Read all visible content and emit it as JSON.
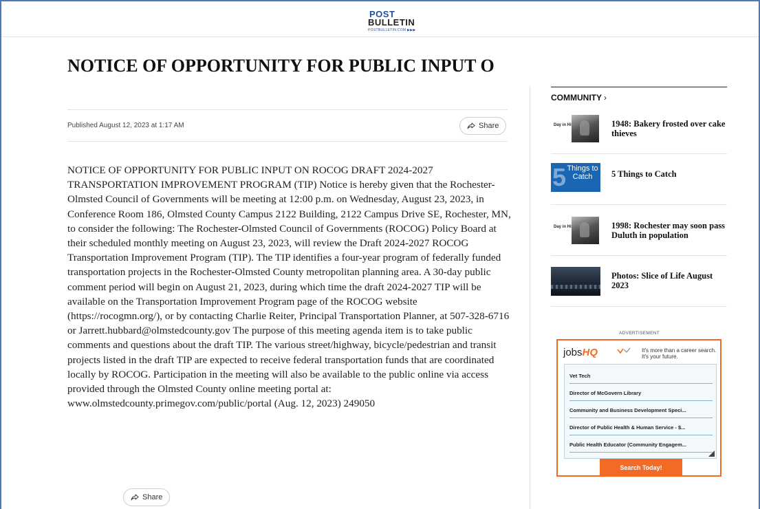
{
  "header": {
    "logo_line1": "POST",
    "logo_line2": "BULLETIN",
    "logo_line3": "POSTBULLETIN.COM ▶▶▶"
  },
  "article": {
    "headline": "NOTICE OF OPPORTUNITY FOR PUBLIC INPUT O",
    "published": "Published August 12, 2023 at 1:17 AM",
    "share_label": "Share",
    "body": "NOTICE OF OPPORTUNITY FOR PUBLIC INPUT ON ROCOG DRAFT 2024-2027 TRANSPORTATION IMPROVEMENT PROGRAM (TIP) Notice is hereby given that the Rochester-Olmsted Council of Governments will be meeting at 12:00 p.m. on Wednesday, August 23, 2023, in Conference Room 186, Olmsted County Campus 2122 Building, 2122 Campus Drive SE, Rochester, MN, to consider the following: The Rochester-Olmsted Council of Governments (ROCOG) Policy Board at their scheduled monthly meeting on August 23, 2023, will review the Draft 2024-2027 ROCOG Transportation Improvement Program (TIP). The TIP identifies a four-year program of federally funded transportation projects in the Rochester-Olmsted County metropolitan planning area. A 30-day public comment period will begin on August 21, 2023, during which time the draft 2024-2027 TIP will be available on the Transportation Improvement Program page of the ROCOG website (https://rocogmn.org/), or by contacting Charlie Reiter, Principal Transportation Planner, at 507-328-6716 or Jarrett.hubbard@olmstedcounty.gov The purpose of this meeting agenda item is to take public comments and questions about the draft TIP. The various street/highway, bicycle/pedestrian and transit projects listed in the draft TIP are expected to receive federal transportation funds that are coordinated locally by ROCOG. Participation in the meeting will also be available to the public online via access provided through the Olmsted County online meeting portal at: www.olmstedcounty.primegov.com/public/portal (Aug. 12, 2023) 249050"
  },
  "sidebar": {
    "section_title": "COMMUNITY",
    "section_chevron": "›",
    "items": [
      {
        "title": "1948: Bakery frosted over cake thieves",
        "thumb_text": "Day in History"
      },
      {
        "title": "5 Things to Catch",
        "thumb_big": "5",
        "thumb_text": "Things to Catch"
      },
      {
        "title": "1998: Rochester may soon pass Duluth in population",
        "thumb_text": "Day in History"
      },
      {
        "title": "Photos: Slice of Life August 2023"
      }
    ]
  },
  "ad": {
    "label": "ADVERTISEMENT",
    "logo_plain": "jobs",
    "logo_brand": "HQ",
    "tagline": "It's more than a career search. It's your future.",
    "jobs": [
      "Vet Tech",
      "Director of McGovern Library",
      "Community and Business Development Speci...",
      "Director of Public Health & Human Service - $...",
      "Public Health Educator (Community Engagem..."
    ],
    "button_label": "Search Today!",
    "accent_color": "#f26a23"
  }
}
